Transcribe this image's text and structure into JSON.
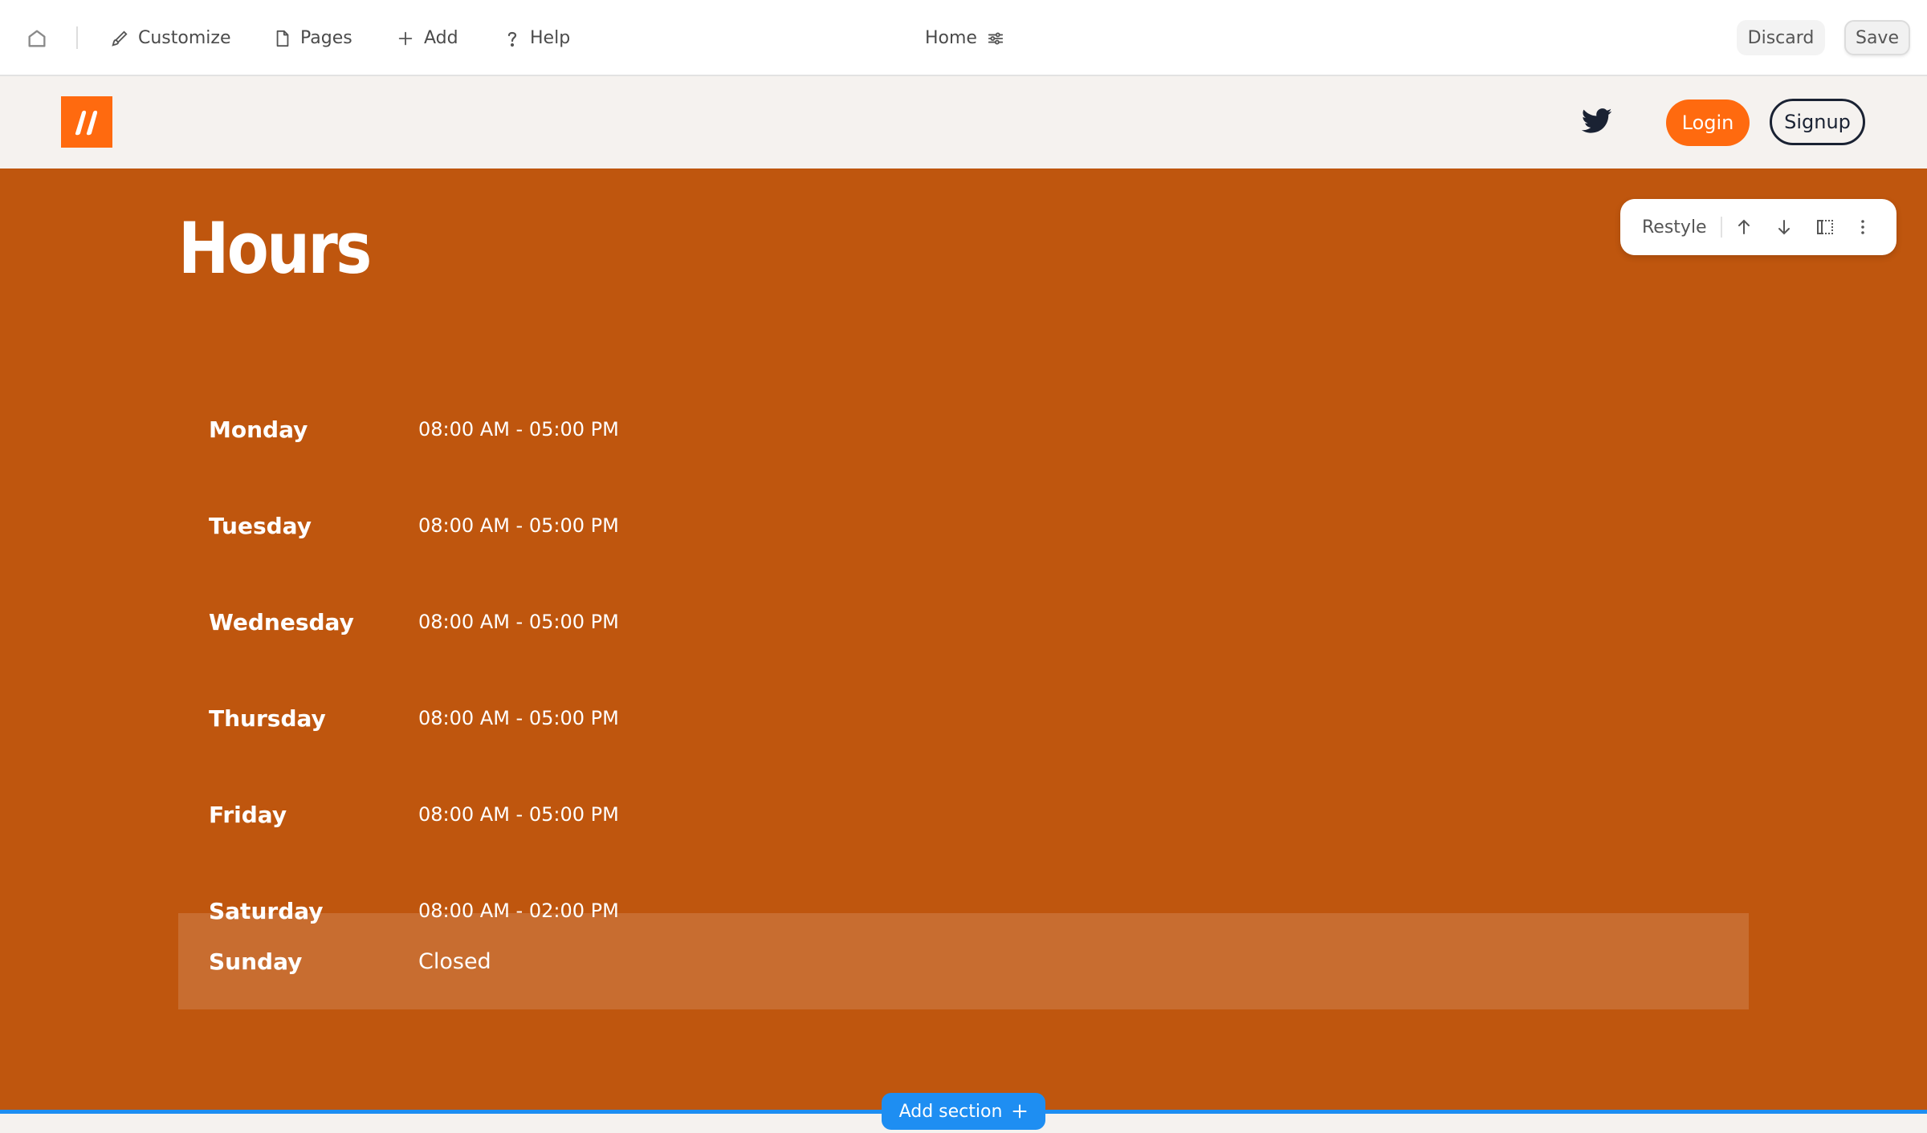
{
  "editor": {
    "customize_label": "Customize",
    "pages_label": "Pages",
    "add_label": "Add",
    "help_label": "Help",
    "current_page": "Home",
    "discard_label": "Discard",
    "save_label": "Save"
  },
  "header": {
    "login_label": "Login",
    "signup_label": "Signup",
    "brand_color": "#ff6a0f"
  },
  "hours": {
    "title": "Hours",
    "section_color": "#bf560e",
    "rows": [
      {
        "day": "Monday",
        "time": "08:00 AM - 05:00 PM"
      },
      {
        "day": "Tuesday",
        "time": "08:00 AM - 05:00 PM"
      },
      {
        "day": "Wednesday",
        "time": "08:00 AM - 05:00 PM"
      },
      {
        "day": "Thursday",
        "time": "08:00 AM - 05:00 PM"
      },
      {
        "day": "Friday",
        "time": "08:00 AM - 05:00 PM"
      },
      {
        "day": "Saturday",
        "time": "08:00 AM - 02:00 PM"
      },
      {
        "day": "Sunday",
        "time": "Closed"
      }
    ],
    "highlighted_day": "Sunday"
  },
  "section_toolbar": {
    "restyle_label": "Restyle",
    "icons": [
      "arrow-up-icon",
      "arrow-down-icon",
      "layout-icon",
      "more-vertical-icon"
    ]
  },
  "add_section": {
    "label": "Add section",
    "accent_color": "#1e8ef2"
  }
}
